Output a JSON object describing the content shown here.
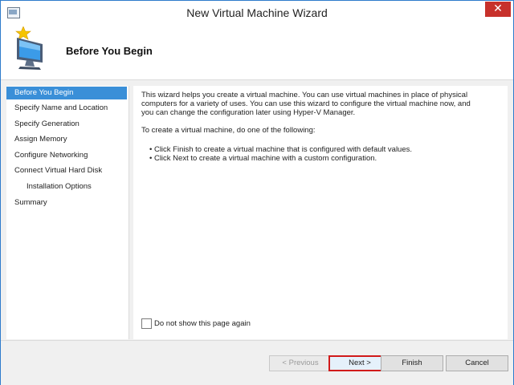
{
  "window": {
    "title": "New Virtual Machine Wizard",
    "close_glyph": "✕"
  },
  "header": {
    "title": "Before You Begin",
    "icon": "monitor-star-icon"
  },
  "nav": {
    "items": [
      {
        "label": "Before You Begin",
        "active": true
      },
      {
        "label": "Specify Name and Location"
      },
      {
        "label": "Specify Generation"
      },
      {
        "label": "Assign Memory"
      },
      {
        "label": "Configure Networking"
      },
      {
        "label": "Connect Virtual Hard Disk"
      },
      {
        "label": "Installation Options",
        "sub": true
      },
      {
        "label": "Summary"
      }
    ]
  },
  "content": {
    "intro_line1": "This wizard helps you create a virtual machine. You can use virtual machines in place of physical",
    "intro_line2": "computers for a variety of uses. You can use this wizard to configure the virtual machine now, and",
    "intro_line3": "you can change the configuration later using Hyper-V Manager.",
    "instruction": "To create a virtual machine, do one of the following:",
    "bullets": [
      "• Click Finish to create a virtual machine that is configured with default values.",
      "• Click Next to create a virtual machine with a custom configuration."
    ],
    "checkbox_label": "Do not show this page again",
    "checkbox_checked": false
  },
  "buttons": {
    "previous": "< Previous",
    "next": "Next >",
    "finish": "Finish",
    "cancel": "Cancel"
  },
  "colors": {
    "window_border": "#2e7ccc",
    "close_red": "#c7312b",
    "nav_active": "#3a8fd8",
    "next_highlight": "#d11a1a"
  }
}
